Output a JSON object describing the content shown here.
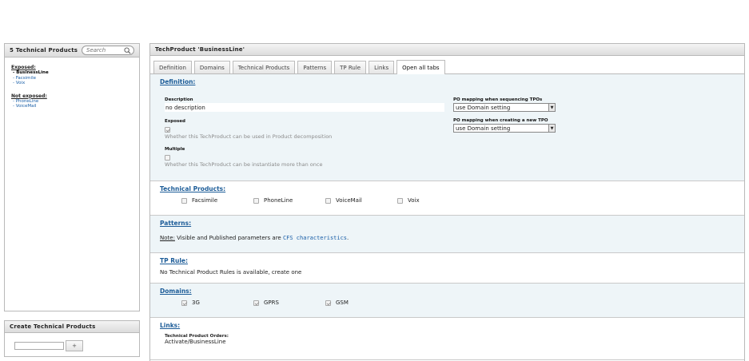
{
  "sidebar": {
    "count_title": "5 Technical Products",
    "search_placeholder": "Search",
    "exposed_title": "Exposed:",
    "exposed_items": [
      "- BusinessLine",
      "- Facsimile",
      "- Voix"
    ],
    "not_exposed_title": "Not exposed:",
    "not_exposed_items": [
      "- PhoneLine",
      "- VoiceMail"
    ]
  },
  "create": {
    "title": "Create Technical Products",
    "input_value": "",
    "add_label": "+"
  },
  "main": {
    "title": "TechProduct 'BusinessLine'",
    "tabs": [
      {
        "label": "Definition"
      },
      {
        "label": "Domains"
      },
      {
        "label": "Technical Products"
      },
      {
        "label": "Patterns"
      },
      {
        "label": "TP Rule"
      },
      {
        "label": "Links"
      },
      {
        "label": "Open all tabs",
        "active": true
      }
    ]
  },
  "definition": {
    "title": "Definition:",
    "description_label": "Description",
    "description_value": "no description",
    "exposed_label": "Exposed",
    "exposed_checked": true,
    "exposed_hint": "Whether this TechProduct can be used in Product decomposition",
    "multiple_label": "Multiple",
    "multiple_checked": false,
    "multiple_hint": "Whether this TechProduct can be instantiate more than once",
    "po_seq_label": "PO mapping when sequencing TPOs",
    "po_seq_value": "use Domain setting",
    "po_create_label": "PO mapping when creating a new TPO",
    "po_create_value": "use Domain setting"
  },
  "technical_products": {
    "title": "Technical Products:",
    "items": [
      "Facsimile",
      "PhoneLine",
      "VoiceMail",
      "Voix"
    ]
  },
  "patterns": {
    "title": "Patterns:",
    "note_label": "Note:",
    "note_text": " Visible and Published parameters are ",
    "note_link": "CFS characteristics",
    "note_end": "."
  },
  "tp_rule": {
    "title": "TP Rule:",
    "text": "No Technical Product Rules is available, create one"
  },
  "domains": {
    "title": "Domains:",
    "items": [
      "3G",
      "GPRS",
      "GSM"
    ]
  },
  "links": {
    "title": "Links:",
    "orders_label": "Technical Product Orders:",
    "orders_value": "Activate/BusinessLine"
  },
  "colors": {
    "link": "#1a5fa8",
    "section_title": "#1c5c98",
    "section_bg": "#eef5f8"
  }
}
